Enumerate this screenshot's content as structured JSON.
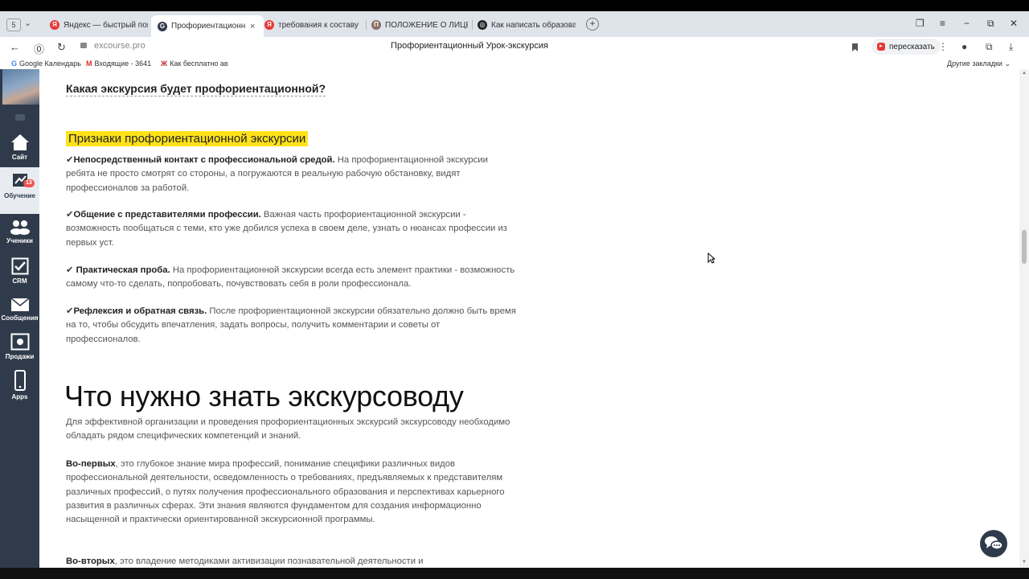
{
  "browser": {
    "tab_count": "5",
    "tabs": [
      {
        "title": "Яндекс — быстрый поиск",
        "icon": "yandex-icon",
        "color": "#e53935",
        "letter": "Я"
      },
      {
        "title": "Профориентационный",
        "icon": "getcourse-icon",
        "color": "#2f3b4a",
        "letter": "G",
        "active": true
      },
      {
        "title": "требования к составу обр",
        "icon": "yandex-icon",
        "color": "#e53935",
        "letter": "Я"
      },
      {
        "title": "ПОЛОЖЕНИЕ О ЛИЦЕНЗ",
        "icon": "document-site-icon",
        "color": "#8d6e63",
        "letter": "П"
      },
      {
        "title": "Как написать образовате",
        "icon": "chatgpt-icon",
        "color": "#222222",
        "letter": "◎"
      }
    ],
    "close_tab": "×",
    "new_tab": "+",
    "url": "excourse.pro",
    "page_title": "Профориентационный Урок-экскурсия",
    "retell_label": "пересказать",
    "bookmarks": [
      {
        "label": "Google Календарь",
        "mark": "G"
      },
      {
        "label": "Входящие - 3641",
        "mark": "M"
      },
      {
        "label": "Как бесплатно ав",
        "mark": "Ж"
      }
    ],
    "other_bookmarks": "Другие закладки"
  },
  "sidebar": {
    "items": [
      {
        "label": "Сайт",
        "icon": "home-icon"
      },
      {
        "label": "Обучение",
        "icon": "training-icon",
        "badge": "13",
        "active": true
      },
      {
        "label": "Ученики",
        "icon": "students-icon"
      },
      {
        "label": "CRM",
        "icon": "crm-check-icon"
      },
      {
        "label": "Сообщения",
        "icon": "messages-icon"
      },
      {
        "label": "Продажи",
        "icon": "sales-icon"
      },
      {
        "label": "Apps",
        "icon": "phone-icon"
      }
    ]
  },
  "article": {
    "question_heading": "Какая экскурсия будет профориентационной?",
    "highlight_heading": "Признаки профориентационной экскурсии",
    "check_mark": "✔",
    "signs": [
      {
        "title": "Непосредственный контакт с профессиональной средой.",
        "text": " На профориентационной экскурсии ребята не просто смотрят со стороны, а погружаются в реальную рабочую обстановку, видят профессионалов за работой."
      },
      {
        "title": "Общение с представителями профессии.",
        "text": " Важная часть профориентационной экскурсии - возможность пообщаться с теми, кто уже добился успеха в своем деле, узнать о нюансах профессии из первых уст."
      },
      {
        "title": " Практическая проба.",
        "text": " На профориентационной экскурсии всегда есть элемент практики - возможность самому что-то сделать, попробовать, почувствовать себя в роли профессионала."
      },
      {
        "title": "Рефлексия и обратная связь.",
        "text": " После профориентационной экскурсии обязательно должно быть время на то, чтобы обсудить впечатления, задать вопросы, получить комментарии и советы от профессионалов."
      }
    ],
    "main_heading": "Что нужно знать экскурсоводу",
    "intro": "Для эффективной организации и проведения профориентационных экскурсий экскурсоводу необходимо обладать рядом специфических компетенций и знаний.",
    "first_lead": "Во-первых",
    "first_text": ", это глубокое знание мира профессий, понимание специфики различных видов профессиональной деятельности, осведомленность о требованиях, предъявляемых к представителям различных профессий, о путях получения профессионального образования и перспективах карьерного развития в различных сферах. Эти знания являются фундаментом для создания информационно насыщенной и практически ориентированной экскурсионной программы.",
    "second_lead": "Во-вторых",
    "second_text": ", это владение методиками активизации познавательной деятельности и"
  }
}
